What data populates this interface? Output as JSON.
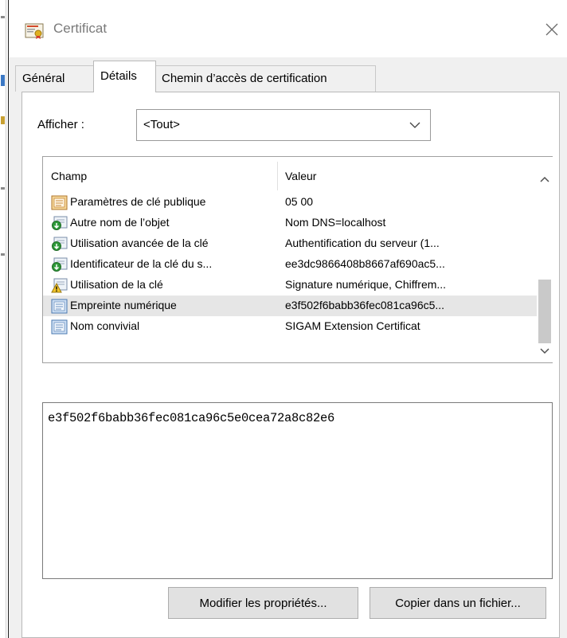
{
  "window": {
    "title": "Certificat"
  },
  "tabs": [
    {
      "label": "Général",
      "active": false
    },
    {
      "label": "Détails",
      "active": true
    },
    {
      "label": "Chemin d’accès de certification",
      "active": false
    }
  ],
  "show": {
    "label": "Afficher :",
    "selected": "<Tout>"
  },
  "fields": {
    "columns": [
      "Champ",
      "Valeur"
    ],
    "rows": [
      {
        "icon": "document-icon",
        "name": "Paramètres de clé publique",
        "value": "05 00",
        "selected": false
      },
      {
        "icon": "extension-icon",
        "name": "Autre nom de l’objet",
        "value": "Nom DNS=localhost",
        "selected": false
      },
      {
        "icon": "extension-icon",
        "name": "Utilisation avancée de la clé",
        "value": "Authentification du serveur (1...",
        "selected": false
      },
      {
        "icon": "extension-icon",
        "name": "Identificateur de la clé du s...",
        "value": "ee3dc9866408b8667af690ac5...",
        "selected": false
      },
      {
        "icon": "warning-extension-icon",
        "name": "Utilisation de la clé",
        "value": "Signature numérique, Chiffrem...",
        "selected": false
      },
      {
        "icon": "document-blue-icon",
        "name": "Empreinte numérique",
        "value": "e3f502f6babb36fec081ca96c5...",
        "selected": true
      },
      {
        "icon": "document-blue-icon",
        "name": "Nom convivial",
        "value": "SIGAM Extension Certificat",
        "selected": false
      }
    ]
  },
  "detail_value": "e3f502f6babb36fec081ca96c5e0cea72a8c82e6",
  "buttons": {
    "edit_properties": "Modifier les propriétés...",
    "copy_to_file": "Copier dans un fichier..."
  },
  "colors": {
    "selection": "#e6e6e6",
    "panel_border": "#b9b9b9",
    "button_face": "#e1e1e1"
  }
}
